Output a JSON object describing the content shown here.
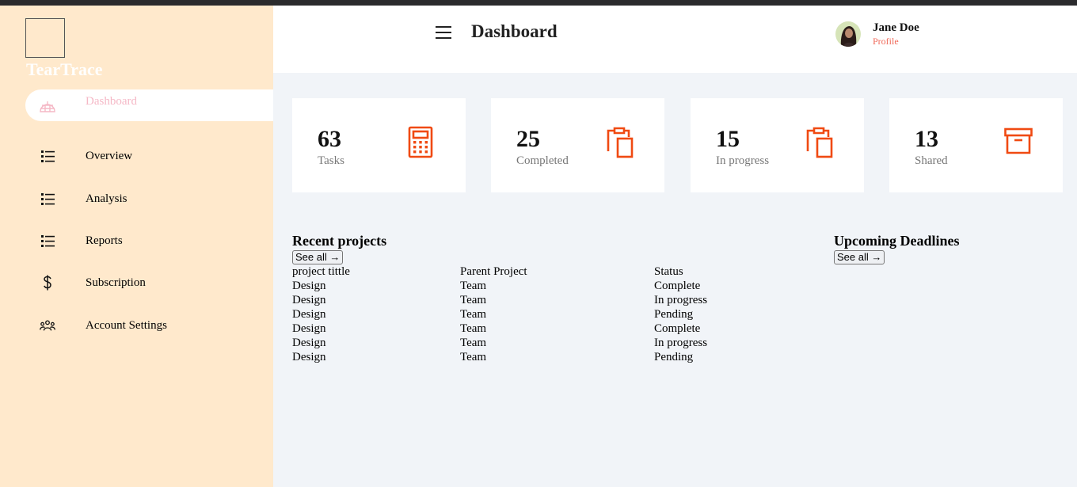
{
  "brand": {
    "name": "TearTrace"
  },
  "sidebar": {
    "items": [
      {
        "label": "Dashboard",
        "icon": "igloo-icon",
        "active": true
      },
      {
        "label": "Overview",
        "icon": "list-icon"
      },
      {
        "label": "Analysis",
        "icon": "list-icon"
      },
      {
        "label": "Reports",
        "icon": "list-icon"
      },
      {
        "label": "Subscription",
        "icon": "dollar-icon"
      },
      {
        "label": "Account Settings",
        "icon": "users-icon"
      }
    ]
  },
  "header": {
    "title": "Dashboard",
    "user_name": "Jane Doe",
    "profile_label": "Profile"
  },
  "cards": [
    {
      "value": "63",
      "label": "Tasks",
      "icon": "calculator-icon"
    },
    {
      "value": "25",
      "label": "Completed",
      "icon": "clipboard-icon"
    },
    {
      "value": "15",
      "label": "In progress",
      "icon": "clipboard-icon"
    },
    {
      "value": "13",
      "label": "Shared",
      "icon": "archive-icon"
    }
  ],
  "recent_projects": {
    "title": "Recent projects",
    "see_all": "See all →",
    "columns": [
      "project tittle",
      "Parent Project",
      "Status"
    ],
    "rows": [
      [
        "Design",
        "Team",
        "Complete"
      ],
      [
        "Design",
        "Team",
        "In progress"
      ],
      [
        "Design",
        "Team",
        "Pending"
      ],
      [
        "Design",
        "Team",
        "Complete"
      ],
      [
        "Design",
        "Team",
        "In progress"
      ],
      [
        "Design",
        "Team",
        "Pending"
      ]
    ]
  },
  "upcoming": {
    "title": "Upcoming Deadlines",
    "see_all": "See all →"
  },
  "colors": {
    "sidebar_bg": "#ffe9cc",
    "accent": "#f04a12",
    "page_bg": "#f1f4f8",
    "active_label": "#f5b8c6",
    "profile_link": "#f06a5a"
  }
}
